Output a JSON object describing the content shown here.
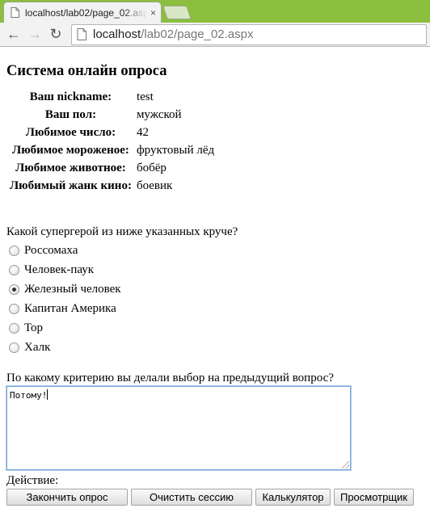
{
  "browser": {
    "tab_title": "localhost/lab02/page_02.aspx",
    "tab_close": "×",
    "url_host": "localhost",
    "url_path": "/lab02/page_02.aspx",
    "back_icon": "←",
    "forward_icon": "→",
    "reload_icon": "↻"
  },
  "page": {
    "title": "Система онлайн опроса",
    "info": [
      {
        "label": "Ваш nickname:",
        "value": "test"
      },
      {
        "label": "Ваш пол:",
        "value": "мужской"
      },
      {
        "label": "Любимое число:",
        "value": "42"
      },
      {
        "label": "Любимое мороженое:",
        "value": "фруктовый лёд"
      },
      {
        "label": "Любимое животное:",
        "value": "бобёр"
      },
      {
        "label": "Любимый жанк кино:",
        "value": "боевик"
      }
    ],
    "question1": "Какой супергерой из ниже указанных круче?",
    "options": [
      {
        "label": "Россомаха",
        "checked": false
      },
      {
        "label": "Человек-паук",
        "checked": false
      },
      {
        "label": "Железный человек",
        "checked": true
      },
      {
        "label": "Капитан Америка",
        "checked": false
      },
      {
        "label": "Тор",
        "checked": false
      },
      {
        "label": "Халк",
        "checked": false
      }
    ],
    "question2": "По какому критерию вы делали выбор на предыдущий вопрос?",
    "answer_text": "Потому!",
    "action_label": "Действие:",
    "buttons": {
      "finish": "Закончить опрос",
      "clear": "Очистить сессию",
      "calculator": "Калькулятор",
      "viewer": "Просмотрщик"
    }
  }
}
